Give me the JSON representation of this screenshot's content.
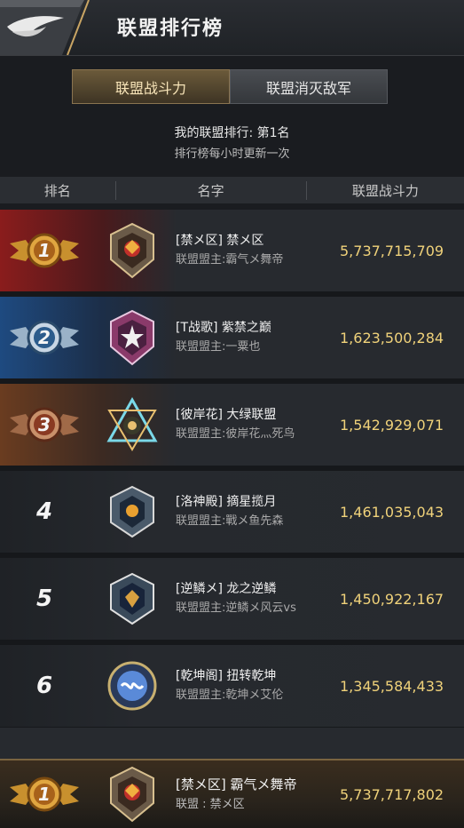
{
  "header": {
    "title": "联盟排行榜"
  },
  "tabs": [
    {
      "label": "联盟战斗力",
      "active": true
    },
    {
      "label": "联盟消灭敌军",
      "active": false
    }
  ],
  "info": {
    "my_rank": "我的联盟排行: 第1名",
    "update_note": "排行榜每小时更新一次"
  },
  "columns": {
    "rank": "排名",
    "name": "名字",
    "power": "联盟战斗力"
  },
  "rows": [
    {
      "rank": "1",
      "name": "[禁メ区] 禁メ区",
      "leader": "联盟盟主:霸气メ舞帝",
      "power": "5,737,715,709"
    },
    {
      "rank": "2",
      "name": "[T战歌] 紫禁之巅",
      "leader": "联盟盟主:一粟也",
      "power": "1,623,500,284"
    },
    {
      "rank": "3",
      "name": "[彼岸花] 大绿联盟",
      "leader": "联盟盟主:彼岸花灬死鸟",
      "power": "1,542,929,071"
    },
    {
      "rank": "4",
      "name": "[洛神殿] 摘星揽月",
      "leader": "联盟盟主:戰メ鱼先森",
      "power": "1,461,035,043"
    },
    {
      "rank": "5",
      "name": "[逆鳞メ] 龙之逆鳞",
      "leader": "联盟盟主:逆鳞メ风云vs",
      "power": "1,450,922,167"
    },
    {
      "rank": "6",
      "name": "[乾坤阁] 扭转乾坤",
      "leader": "联盟盟主:乾坤メ艾伦",
      "power": "1,345,584,433"
    }
  ],
  "footer": {
    "rank": "1",
    "name": "[禁メ区] 霸气メ舞帝",
    "alliance": "联盟 : 禁メ区",
    "power": "5,737,717,802"
  },
  "colors": {
    "gold_text": "#f0d27a",
    "rank1": "#8a1c1c",
    "rank2": "#1e4a80",
    "rank3": "#6a3c20"
  }
}
